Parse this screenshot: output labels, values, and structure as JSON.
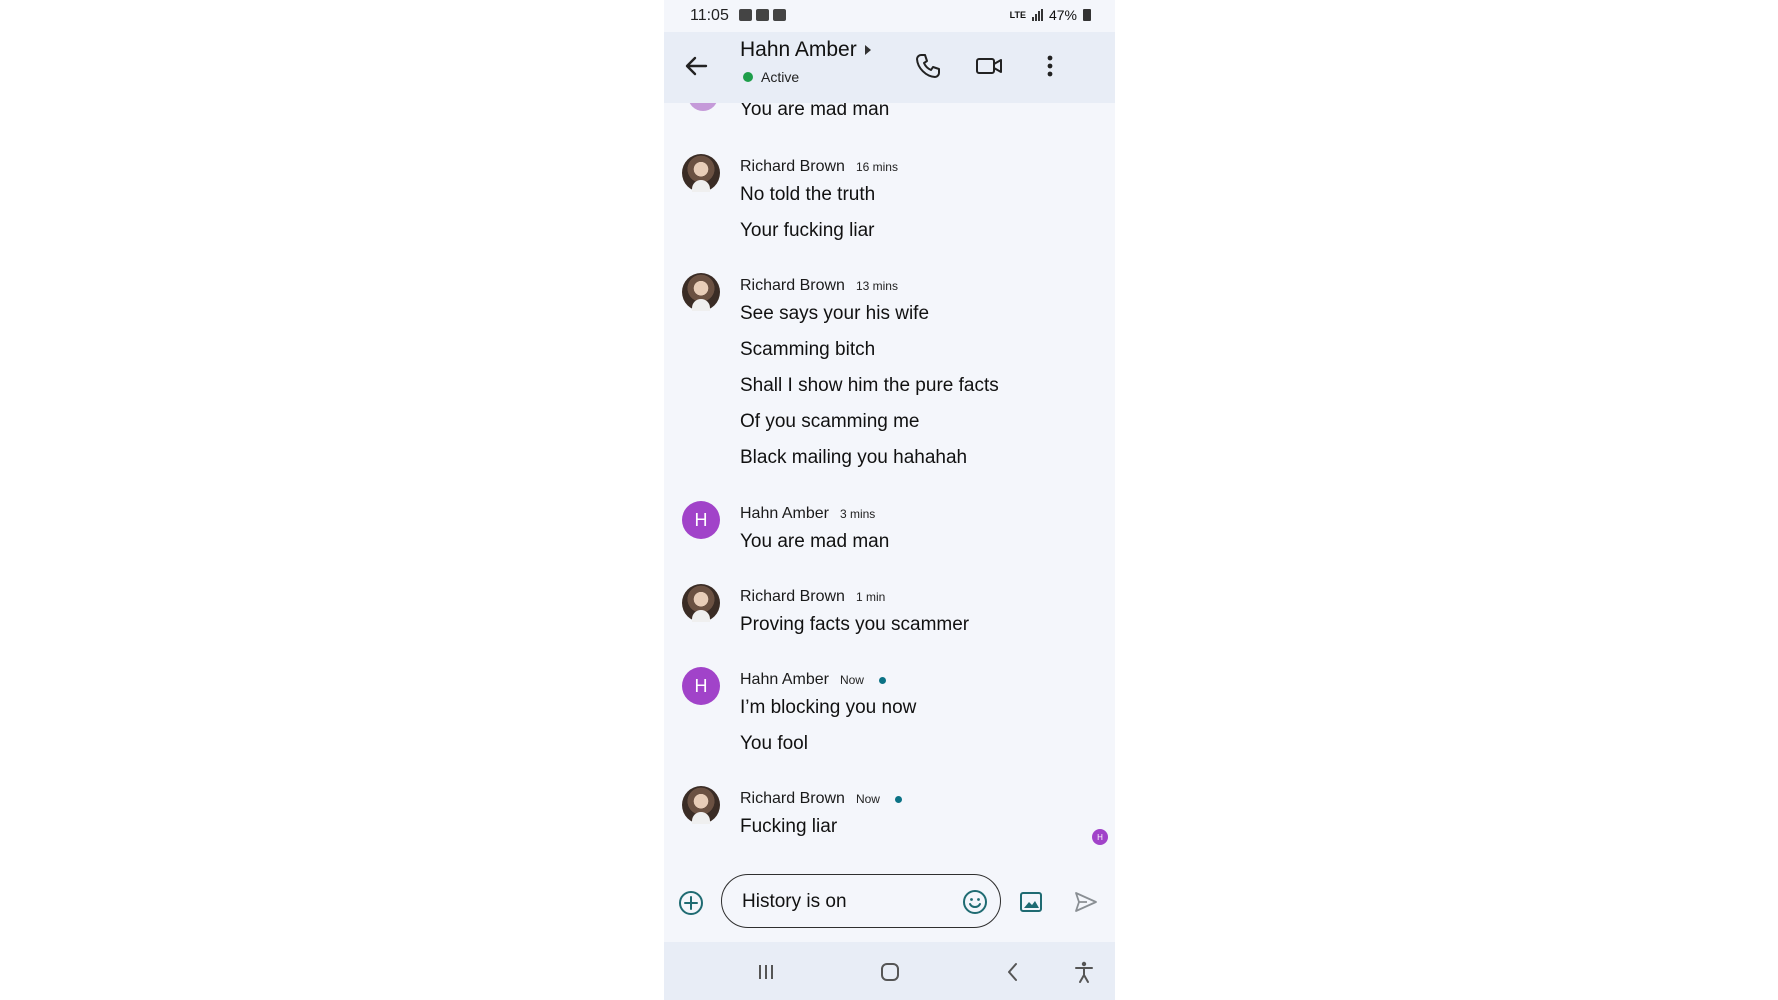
{
  "status_bar": {
    "time": "11:05",
    "network": "LTE",
    "battery": "47%"
  },
  "header": {
    "title": "Hahn Amber",
    "presence": "Active",
    "icons": {
      "back": "arrow-left-icon",
      "call": "phone-icon",
      "video": "video-camera-icon",
      "more": "more-vert-icon"
    }
  },
  "messages": {
    "partial_top": "You are mad man",
    "groups": [
      {
        "sender": "Richard Brown",
        "time": "16 mins",
        "avatar": "photo",
        "lines": [
          "No told the truth",
          "Your  fucking liar"
        ]
      },
      {
        "sender": "Richard Brown",
        "time": "13 mins",
        "avatar": "photo",
        "lines": [
          "See says your his wife",
          "Scamming bitch",
          "Shall I show him the pure facts",
          "Of you scamming me",
          "Black mailing you hahahah"
        ]
      },
      {
        "sender": "Hahn Amber",
        "time": "3 mins",
        "avatar": "H",
        "lines": [
          "You are mad man"
        ]
      },
      {
        "sender": "Richard Brown",
        "time": "1 min",
        "avatar": "photo",
        "lines": [
          "Proving facts you scammer"
        ]
      },
      {
        "sender": "Hahn Amber",
        "time": "Now",
        "avatar": "H",
        "lines": [
          "I’m blocking you now",
          "You fool"
        ]
      },
      {
        "sender": "Richard Brown",
        "time": "Now",
        "avatar": "photo",
        "lines": [
          "Fucking liar"
        ]
      }
    ],
    "read_receipt": "H"
  },
  "composer": {
    "value": "History is on",
    "icons": {
      "add": "add-circle-icon",
      "emoji": "emoji-icon",
      "image": "image-icon",
      "send": "send-icon"
    }
  },
  "nav_bar": {
    "icons": [
      "recents-icon",
      "home-icon",
      "back-icon",
      "accessibility-icon"
    ]
  },
  "colors": {
    "accent_avatar": "#a143c9",
    "presence_dot": "#1e9e4a",
    "seen_dot": "#0b7285"
  }
}
